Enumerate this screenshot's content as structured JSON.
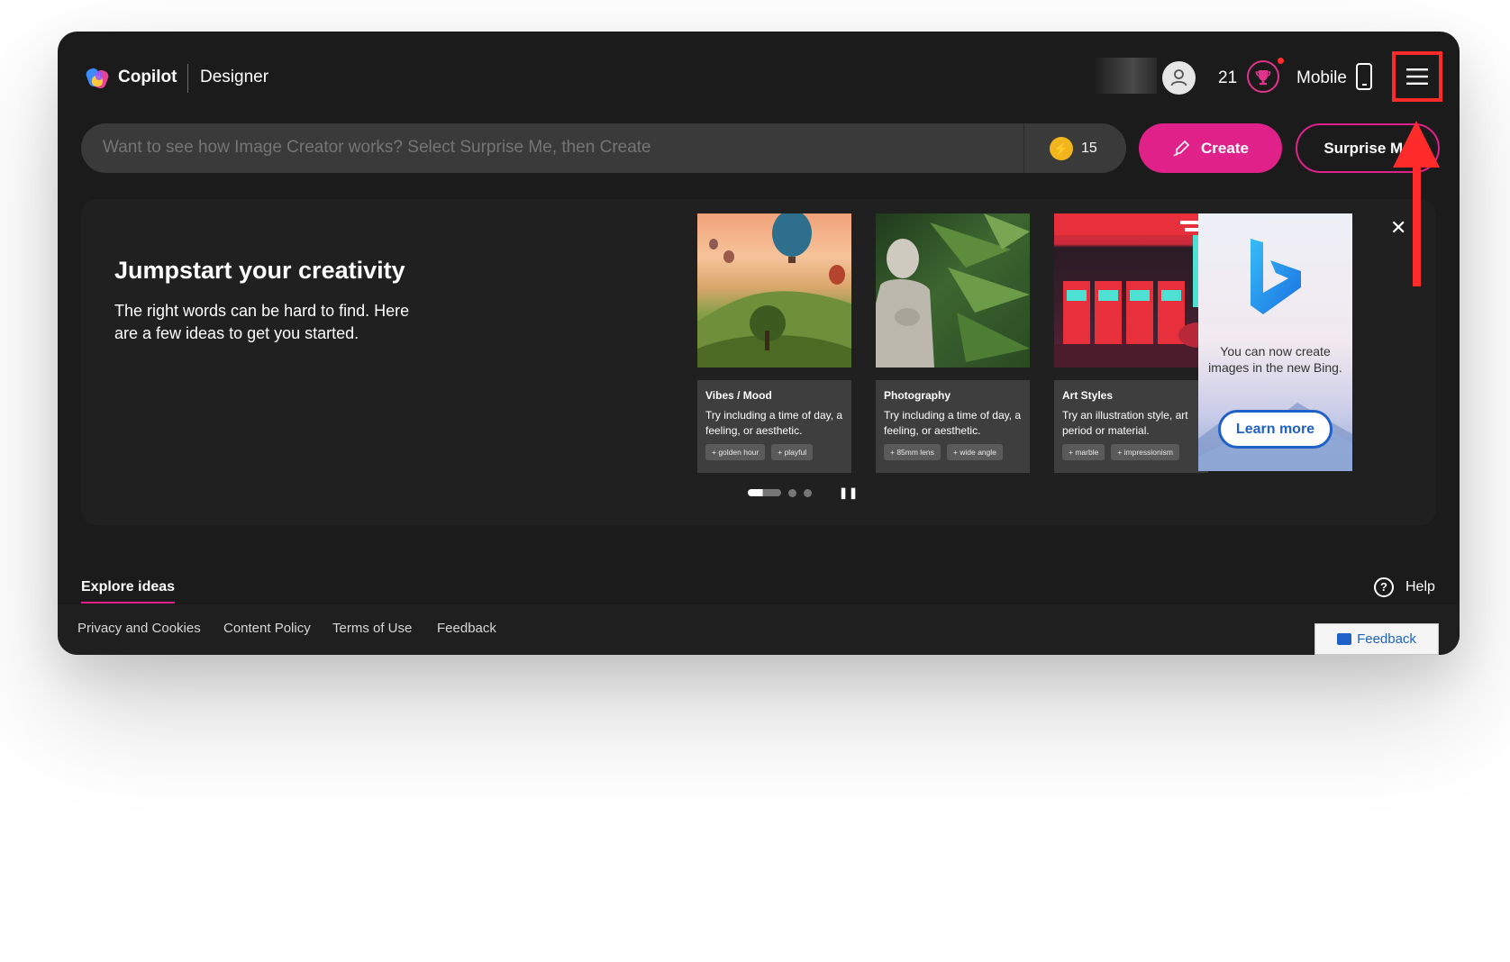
{
  "header": {
    "brand": "Copilot",
    "product": "Designer",
    "rewards_count": "21",
    "mobile_label": "Mobile"
  },
  "search": {
    "placeholder": "Want to see how Image Creator works? Select Surprise Me, then Create",
    "boosts": "15",
    "create_label": "Create",
    "surprise_label": "Surprise Me"
  },
  "jumpstart": {
    "title": "Jumpstart your creativity",
    "description": "The right words can be hard to find. Here are a few ideas to get you started.",
    "cards": [
      {
        "category": "Vibes / Mood",
        "tip": "Try including a time of day, a feeling, or aesthetic.",
        "chips": [
          "golden hour",
          "playful"
        ]
      },
      {
        "category": "Photography",
        "tip": "Try including a time of day, a feeling, or aesthetic.",
        "chips": [
          "85mm lens",
          "wide angle"
        ]
      },
      {
        "category": "Art Styles",
        "tip": "Try an illustration style, art period or material.",
        "chips": [
          "marble",
          "impressionism"
        ]
      }
    ],
    "promo": {
      "text": "You can now create images in the new Bing.",
      "button": "Learn more"
    }
  },
  "bottom": {
    "explore_tab": "Explore ideas",
    "help_label": "Help"
  },
  "footer": {
    "links": [
      "Privacy and Cookies",
      "Content Policy",
      "Terms of Use",
      "Feedback"
    ],
    "feedback_button": "Feedback"
  },
  "colors": {
    "accent": "#e0218a",
    "highlight": "#ff2a2a",
    "background": "#1b1b1b"
  }
}
